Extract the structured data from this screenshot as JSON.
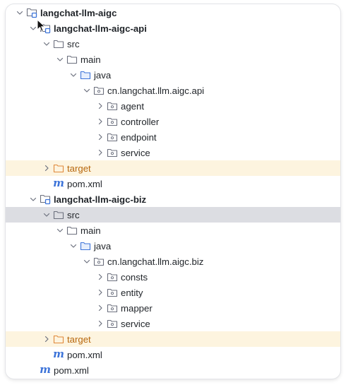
{
  "tree": {
    "rows": [
      {
        "label": "langchat-llm-aigc",
        "depth": 0,
        "icon": "module-folder-icon",
        "chevron": "down",
        "bold": true
      },
      {
        "label": "langchat-llm-aigc-api",
        "depth": 1,
        "icon": "module-folder-icon",
        "chevron": "down",
        "bold": true
      },
      {
        "label": "src",
        "depth": 2,
        "icon": "folder-icon",
        "chevron": "down"
      },
      {
        "label": "main",
        "depth": 3,
        "icon": "folder-icon",
        "chevron": "down"
      },
      {
        "label": "java",
        "depth": 4,
        "icon": "source-folder-icon",
        "chevron": "down"
      },
      {
        "label": "cn.langchat.llm.aigc.api",
        "depth": 5,
        "icon": "package-icon",
        "chevron": "down"
      },
      {
        "label": "agent",
        "depth": 6,
        "icon": "package-icon",
        "chevron": "right"
      },
      {
        "label": "controller",
        "depth": 6,
        "icon": "package-icon",
        "chevron": "right"
      },
      {
        "label": "endpoint",
        "depth": 6,
        "icon": "package-icon",
        "chevron": "right"
      },
      {
        "label": "service",
        "depth": 6,
        "icon": "package-icon",
        "chevron": "right"
      },
      {
        "label": "target",
        "depth": 2,
        "icon": "excluded-folder-icon",
        "chevron": "right",
        "excluded": true
      },
      {
        "label": "pom.xml",
        "depth": 2,
        "icon": "maven-icon",
        "chevron": "none"
      },
      {
        "label": "langchat-llm-aigc-biz",
        "depth": 1,
        "icon": "module-folder-icon",
        "chevron": "down",
        "bold": true
      },
      {
        "label": "src",
        "depth": 2,
        "icon": "folder-icon",
        "chevron": "down",
        "selected": true
      },
      {
        "label": "main",
        "depth": 3,
        "icon": "folder-icon",
        "chevron": "down"
      },
      {
        "label": "java",
        "depth": 4,
        "icon": "source-folder-icon",
        "chevron": "down"
      },
      {
        "label": "cn.langchat.llm.aigc.biz",
        "depth": 5,
        "icon": "package-icon",
        "chevron": "down"
      },
      {
        "label": "consts",
        "depth": 6,
        "icon": "package-icon",
        "chevron": "right"
      },
      {
        "label": "entity",
        "depth": 6,
        "icon": "package-icon",
        "chevron": "right"
      },
      {
        "label": "mapper",
        "depth": 6,
        "icon": "package-icon",
        "chevron": "right"
      },
      {
        "label": "service",
        "depth": 6,
        "icon": "package-icon",
        "chevron": "right"
      },
      {
        "label": "target",
        "depth": 2,
        "icon": "excluded-folder-icon",
        "chevron": "right",
        "excluded": true
      },
      {
        "label": "pom.xml",
        "depth": 2,
        "icon": "maven-icon",
        "chevron": "none"
      },
      {
        "label": "pom.xml",
        "depth": 1,
        "icon": "maven-icon",
        "chevron": "none"
      }
    ]
  },
  "colors": {
    "excluded_background": "#fdf4df",
    "selected_background": "#dcdde2",
    "excluded_text": "#b8680e",
    "module_badge": "#3d74d9",
    "source_folder": "#3d74d9",
    "excluded_folder": "#e0893a"
  }
}
